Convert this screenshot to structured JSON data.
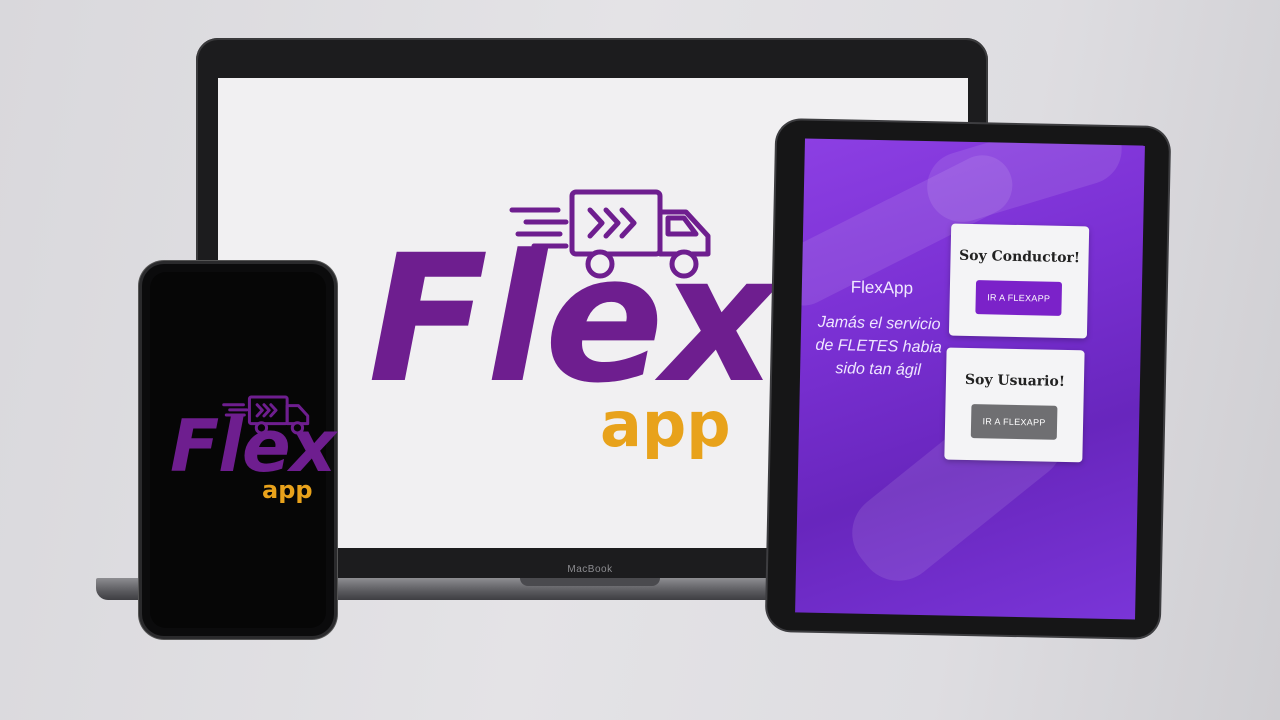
{
  "laptop": {
    "brand_label": "MacBook"
  },
  "logo": {
    "word": "Flex",
    "sub": "app",
    "icon": "delivery-truck-icon",
    "colors": {
      "purple": "#6e1e8f",
      "gold": "#e8a21b"
    }
  },
  "tablet": {
    "app_name": "FlexApp",
    "tagline": "Jamás el servicio de FLETES habia sido tan ágil",
    "cards": [
      {
        "title": "Soy Conductor!",
        "button": "IR A FLEXAPP",
        "button_color": "#7b22c9"
      },
      {
        "title": "Soy Usuario!",
        "button": "IR A FLEXAPP",
        "button_color": "#6f6f72"
      }
    ]
  }
}
